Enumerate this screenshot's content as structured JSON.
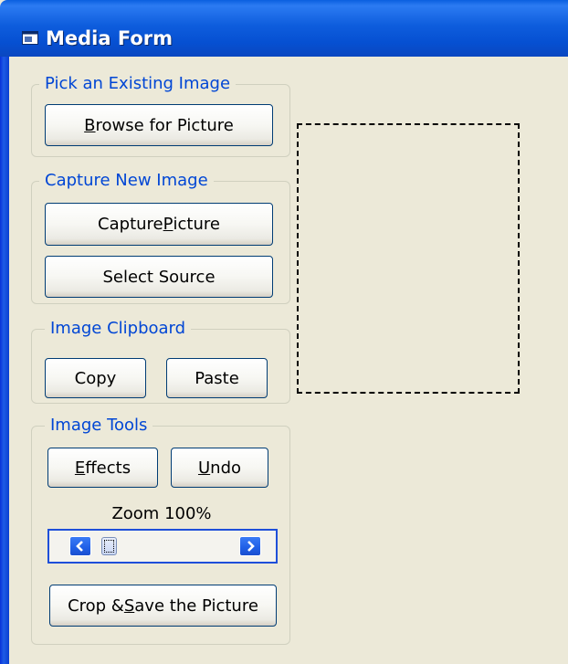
{
  "window": {
    "title": "Media Form",
    "title_icon": "form-window-icon",
    "titlebar_color": "#0A5FE0",
    "background": "#ECE9D8"
  },
  "groups": {
    "existing": {
      "label": "Pick an Existing Image",
      "browse_button": {
        "prefix": "",
        "mnemonic": "B",
        "suffix": "rowse for Picture"
      }
    },
    "capture": {
      "label": "Capture New Image",
      "capture_button": {
        "prefix": "Capture ",
        "mnemonic": "P",
        "suffix": "icture"
      },
      "source_button": {
        "label": "Select Source"
      }
    },
    "clipboard": {
      "label": "Image Clipboard",
      "copy_button": {
        "label": "Copy"
      },
      "paste_button": {
        "label": "Paste"
      }
    },
    "tools": {
      "label": "Image Tools",
      "effects_button": {
        "prefix": "",
        "mnemonic": "E",
        "suffix": "ffects"
      },
      "undo_button": {
        "prefix": "",
        "mnemonic": "U",
        "suffix": "ndo"
      },
      "zoom_label": "Zoom 100%",
      "zoom_scrollbar": {
        "left_icon": "chevron-left-icon",
        "right_icon": "chevron-right-icon",
        "position": 0.05
      },
      "crop_save_button": {
        "prefix": "Crop & ",
        "mnemonic": "S",
        "suffix": "ave the Picture"
      }
    }
  },
  "preview": {
    "type": "empty-image-placeholder"
  },
  "colors": {
    "group_label": "#0046D5",
    "button_border": "#003C74",
    "scroll_arrow": "#1F5FE6"
  }
}
